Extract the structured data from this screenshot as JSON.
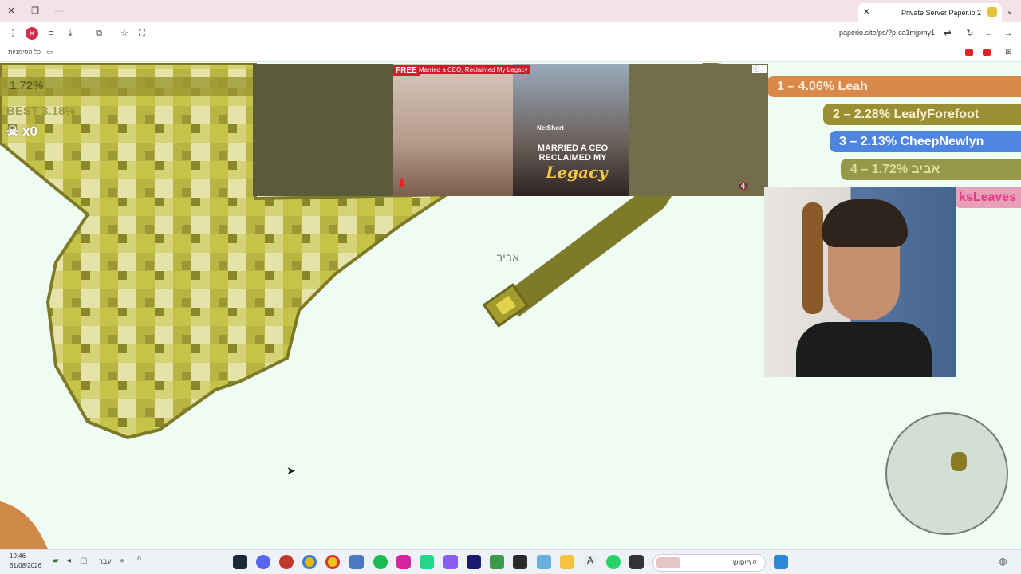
{
  "browser": {
    "tab_title": "Private Server Paper.io 2",
    "url": "paperio.site/ps/?p-ca1mjpmy1",
    "bookmarks_label": "כל הסימניות"
  },
  "hud": {
    "percent": "1.72%",
    "best": "BEST 3.18%",
    "kills": "x0"
  },
  "leaderboard": [
    "1 – 4.06% Leah",
    "2 – 2.28% LeafyForefoot",
    "3 – 2.13% CheepNewlyn",
    "4 – 1.72% אביב",
    "ksLeaves"
  ],
  "player_name": "אביב",
  "ad": {
    "free": "FREE",
    "headline": "Married a CEO, Reclaimed My Legacy",
    "poster_title": "MARRIED A CEO RECLAIMED MY",
    "poster_legacy": "Legacy",
    "brand": "NetShort"
  },
  "taskbar": {
    "time": "19:46",
    "date": "31/08/2026",
    "lang": "עבר",
    "search_placeholder": "חיפוש"
  },
  "colors": {
    "territory_light": "#e3e0a0",
    "territory_mid": "#c6c44e",
    "territory_dark": "#8a8729",
    "trail": "#7d7b2a",
    "background": "#effcf4",
    "enemy": "#cf8a4a"
  }
}
